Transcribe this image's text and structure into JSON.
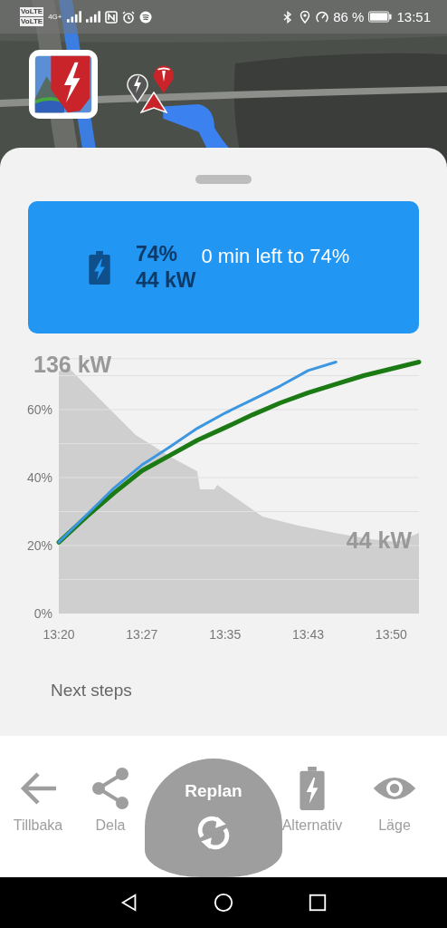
{
  "status_bar": {
    "network_labels": [
      "VoLTE",
      "VoLTE"
    ],
    "network_type": "4G+",
    "battery_percent": "86 %",
    "time": "13:51"
  },
  "charge_card": {
    "soc": "74%",
    "power": "44 kW",
    "message": "0 min left to 74%"
  },
  "chart": {
    "chart_data": {
      "type": "line",
      "categories": [
        "13:20",
        null,
        null,
        "13:27",
        null,
        null,
        "13:35",
        null,
        null,
        "13:43",
        null,
        null,
        "13:50",
        null
      ],
      "grid": true,
      "ylim": [
        0,
        75
      ],
      "yticks": [
        {
          "value": 0,
          "label": "0%"
        },
        {
          "value": 20,
          "label": "20%"
        },
        {
          "value": 40,
          "label": "40%"
        },
        {
          "value": 60,
          "label": "60%"
        }
      ],
      "series": [
        {
          "color": "#3d97e0",
          "values": [
            21,
            29,
            37,
            43.7,
            49,
            54.5,
            59,
            63,
            67,
            71.5,
            74,
            null,
            null,
            null
          ]
        },
        {
          "color": "#1b7a14",
          "values": [
            21,
            28.5,
            35.5,
            42,
            46.5,
            51,
            54.7,
            58.5,
            62,
            65,
            67.5,
            70,
            72,
            74
          ]
        }
      ],
      "annotations": [
        "136 kW",
        "44 kW"
      ]
    }
  },
  "next_steps": {
    "title": "Next steps"
  },
  "bottom_nav": [
    {
      "label": "Tillbaka",
      "kind": "plain"
    },
    {
      "label": "Dela",
      "kind": "plain"
    },
    {
      "label": "Replan",
      "kind": "primary"
    },
    {
      "label": "Alternativ",
      "kind": "plain"
    },
    {
      "label": "Läge",
      "kind": "plain"
    }
  ]
}
